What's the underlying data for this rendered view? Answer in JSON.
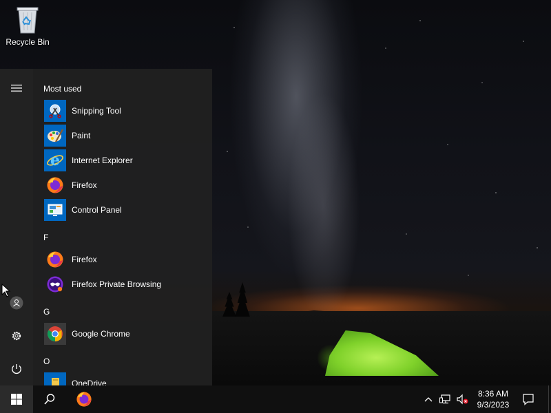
{
  "desktop": {
    "icons": [
      {
        "label": "Recycle Bin",
        "icon": "recycle-bin-icon"
      }
    ]
  },
  "start_menu": {
    "rail": {
      "menu_icon": "hamburger-icon",
      "account_icon": "user-icon",
      "settings_icon": "gear-icon",
      "power_icon": "power-icon"
    },
    "most_used_header": "Most used",
    "most_used": [
      {
        "label": "Snipping Tool",
        "icon": "snipping-tool-icon"
      },
      {
        "label": "Paint",
        "icon": "paint-icon"
      },
      {
        "label": "Internet Explorer",
        "icon": "internet-explorer-icon"
      },
      {
        "label": "Firefox",
        "icon": "firefox-icon"
      },
      {
        "label": "Control Panel",
        "icon": "control-panel-icon"
      }
    ],
    "groups": [
      {
        "letter": "F",
        "items": [
          {
            "label": "Firefox",
            "icon": "firefox-icon"
          },
          {
            "label": "Firefox Private Browsing",
            "icon": "firefox-private-icon"
          }
        ]
      },
      {
        "letter": "G",
        "items": [
          {
            "label": "Google Chrome",
            "icon": "chrome-icon"
          }
        ]
      },
      {
        "letter": "O",
        "items": [
          {
            "label": "OneDrive",
            "icon": "onedrive-icon"
          }
        ]
      }
    ]
  },
  "taskbar": {
    "start_icon": "windows-logo-icon",
    "search_icon": "search-icon",
    "pinned": [
      {
        "label": "Firefox",
        "icon": "firefox-icon"
      }
    ],
    "tray": {
      "chevron_icon": "chevron-up-icon",
      "network_icon": "network-icon",
      "volume_icon": "volume-muted-icon"
    },
    "clock": {
      "time": "8:36 AM",
      "date": "9/3/2023"
    },
    "action_center_icon": "notification-icon"
  },
  "colors": {
    "start_menu_bg": "#202020",
    "tile_blue": "#0067c0",
    "taskbar_bg": "#101010",
    "tent_green": "#7fd12a"
  }
}
